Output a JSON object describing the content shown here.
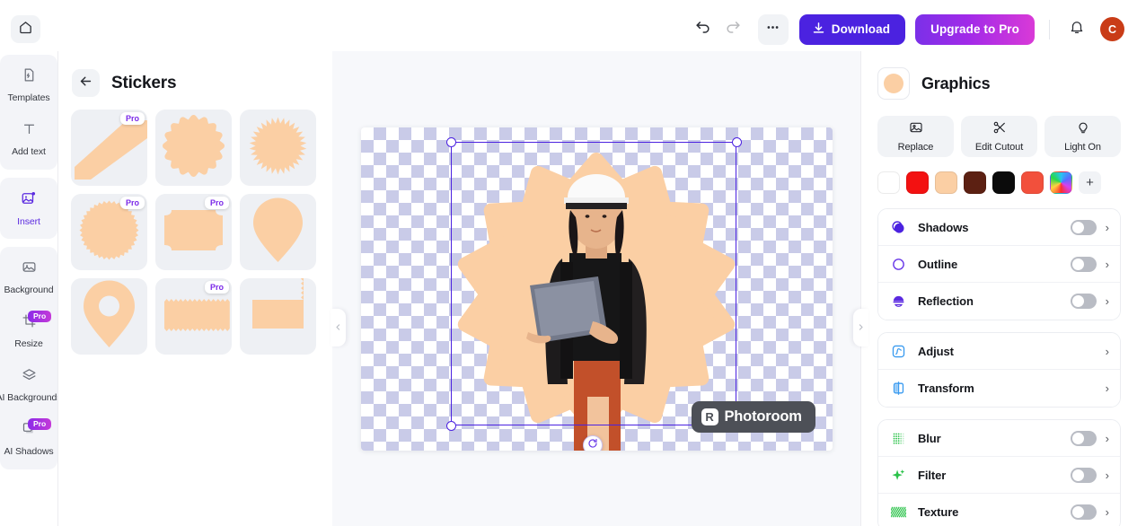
{
  "topbar": {
    "home_icon": "home-icon",
    "undo_icon": "undo-icon",
    "redo_icon": "redo-icon",
    "more_icon": "more-options-icon",
    "download_label": "Download",
    "download_icon": "download-icon",
    "upgrade_label": "Upgrade to Pro",
    "notifications_icon": "bell-icon",
    "avatar_initial": "C",
    "avatar_color": "#c93c17",
    "download_color": "#4b22e0"
  },
  "rail": {
    "groups": [
      {
        "items": [
          {
            "label": "Templates",
            "icon": "template-file-icon",
            "pro": false,
            "active": false
          },
          {
            "label": "Add text",
            "icon": "text-icon",
            "pro": false,
            "active": false
          }
        ]
      },
      {
        "items": [
          {
            "label": "Insert",
            "icon": "insert-image-icon",
            "pro": false,
            "active": true
          }
        ]
      },
      {
        "items": [
          {
            "label": "Background",
            "icon": "background-image-icon",
            "pro": false,
            "active": false
          },
          {
            "label": "Resize",
            "icon": "resize-crop-icon",
            "pro": true,
            "active": false
          },
          {
            "label": "AI Backgrounds",
            "icon": "ai-layers-icon",
            "pro": false,
            "active": false
          },
          {
            "label": "AI Shadows",
            "icon": "shadow-square-icon",
            "pro": true,
            "active": false
          }
        ]
      }
    ],
    "pro_badge_label": "Pro"
  },
  "panel": {
    "back_icon": "back-arrow-icon",
    "title": "Stickers",
    "pro_label": "Pro",
    "stickers": [
      {
        "name": "banner-ribbon-sticker",
        "shape": "ribbon",
        "pro": true
      },
      {
        "name": "scalloped-circle-sticker",
        "shape": "scallop",
        "pro": false
      },
      {
        "name": "sunburst-circle-sticker",
        "shape": "sunburst",
        "pro": false
      },
      {
        "name": "zigzag-circle-sticker",
        "shape": "zigzag-circle",
        "pro": true
      },
      {
        "name": "ticket-label-sticker",
        "shape": "ticket",
        "pro": true
      },
      {
        "name": "teardrop-pin-sticker",
        "shape": "teardrop",
        "pro": false
      },
      {
        "name": "map-pin-sticker",
        "shape": "map-pin",
        "pro": false
      },
      {
        "name": "torn-banner-sticker",
        "shape": "torn-horizontal",
        "pro": true
      },
      {
        "name": "torn-side-banner-sticker",
        "shape": "torn-vertical",
        "pro": false
      }
    ],
    "sticker_color": "#fbcfa4"
  },
  "canvas": {
    "collapse_left_icon": "chevron-left-icon",
    "collapse_right_icon": "chevron-right-icon",
    "rotate_icon": "rotate-icon",
    "watermark_label": "Photoroom",
    "watermark_logo": "photoroom-logo-icon",
    "selection_color": "#4b22e0",
    "badge_shape_color": "#fbcfa4"
  },
  "right": {
    "thumb_icon": "graphics-thumbnail",
    "title": "Graphics",
    "actions": [
      {
        "label": "Replace",
        "icon": "replace-image-icon"
      },
      {
        "label": "Edit Cutout",
        "icon": "scissors-icon"
      },
      {
        "label": "Light On",
        "icon": "lightbulb-icon"
      }
    ],
    "swatches": [
      {
        "name": "swatch-white",
        "color": "#ffffff"
      },
      {
        "name": "swatch-red",
        "color": "#f31111"
      },
      {
        "name": "swatch-peach",
        "color": "#fbcfa4"
      },
      {
        "name": "swatch-dark-brown",
        "color": "#5c2012"
      },
      {
        "name": "swatch-black",
        "color": "#0b0b0b"
      },
      {
        "name": "swatch-coral",
        "color": "#f2503c"
      },
      {
        "name": "swatch-rainbow",
        "color": "rainbow"
      }
    ],
    "add_swatch_label": "+",
    "groups": [
      {
        "rows": [
          {
            "label": "Shadows",
            "icon": "shadows-icon",
            "icon_color": "#4b22e0",
            "toggle": true,
            "on": false,
            "chevron": true
          },
          {
            "label": "Outline",
            "icon": "outline-icon",
            "icon_color": "#6a3ae8",
            "toggle": true,
            "on": false,
            "chevron": true
          },
          {
            "label": "Reflection",
            "icon": "reflection-icon",
            "icon_color": "#5b2ae0",
            "toggle": true,
            "on": false,
            "chevron": true
          }
        ]
      },
      {
        "rows": [
          {
            "label": "Adjust",
            "icon": "adjust-icon",
            "icon_color": "#3a9bf0",
            "toggle": false,
            "on": false,
            "chevron": true
          },
          {
            "label": "Transform",
            "icon": "transform-icon",
            "icon_color": "#3a9bf0",
            "toggle": false,
            "on": false,
            "chevron": true
          }
        ]
      },
      {
        "rows": [
          {
            "label": "Blur",
            "icon": "blur-icon",
            "icon_color": "#2bc24a",
            "toggle": true,
            "on": false,
            "chevron": true
          },
          {
            "label": "Filter",
            "icon": "filter-sparkle-icon",
            "icon_color": "#2bc24a",
            "toggle": true,
            "on": false,
            "chevron": true
          },
          {
            "label": "Texture",
            "icon": "texture-icon",
            "icon_color": "#2bc24a",
            "toggle": true,
            "on": false,
            "chevron": true
          }
        ]
      }
    ],
    "chevron_glyph": "›"
  }
}
